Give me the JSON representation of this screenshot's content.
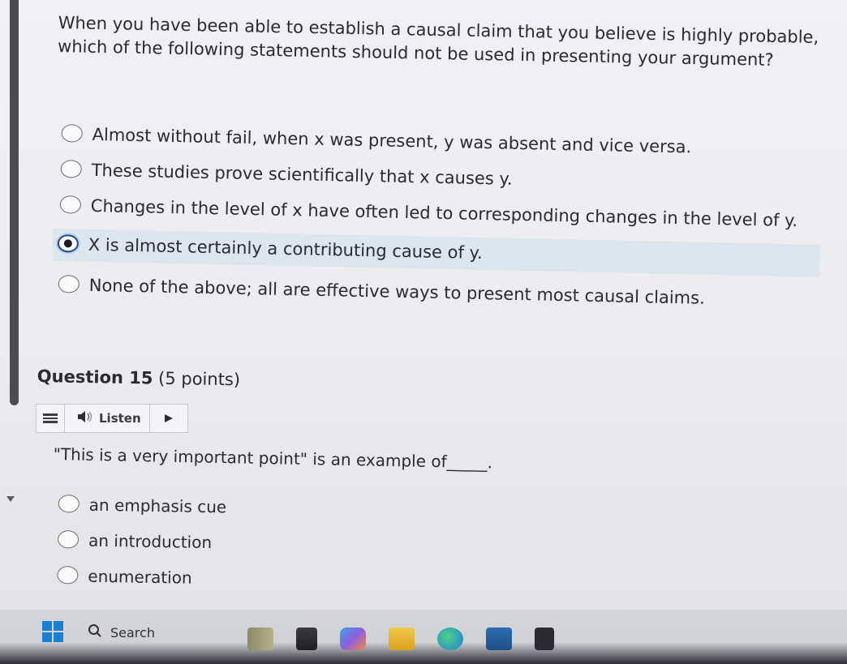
{
  "question14": {
    "prompt": "When you have been able to establish a causal claim that you believe is highly probable, which of the following statements should not be used in presenting your argument?",
    "options": [
      "Almost without fail, when x was present, y was absent and vice versa.",
      "These studies prove scientifically that x causes y.",
      "Changes in the level of x have often led to corresponding changes in the level of y.",
      "X is almost certainly a contributing cause of y.",
      "None of the above; all are effective ways to present most causal claims."
    ],
    "selected_index": 3
  },
  "question15": {
    "number_label": "Question 15",
    "points_label": "(5 points)",
    "listen_label": "Listen",
    "prompt": "\"This is a very important point\" is an example of_____.",
    "options": [
      "an emphasis cue",
      "an introduction",
      "enumeration"
    ]
  },
  "taskbar": {
    "search_label": "Search"
  },
  "colors": {
    "accent": "#1e4c8a",
    "selected_bg": "#dde6ee",
    "windows_blue": "#1a7fd4"
  }
}
